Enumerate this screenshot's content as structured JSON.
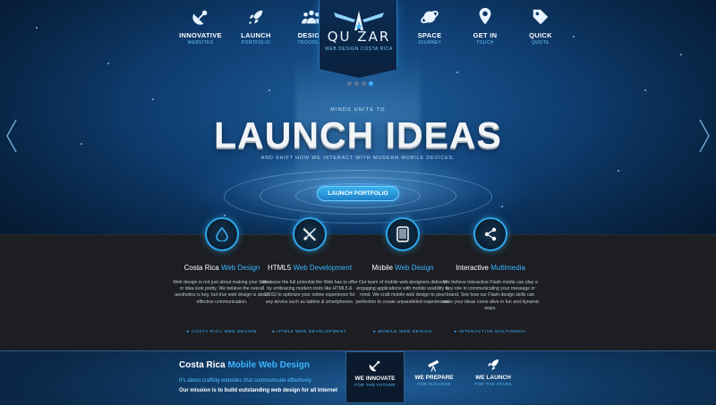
{
  "nav": {
    "left": [
      {
        "label": "INNOVATIVE",
        "sub": "WEBSITES",
        "icon": "satellite-dish-icon"
      },
      {
        "label": "LAUNCH",
        "sub": "PORTFOLIO",
        "icon": "rocket-icon"
      },
      {
        "label": "DESIGN",
        "sub": "TROOPERS",
        "icon": "team-icon"
      }
    ],
    "right": [
      {
        "label": "SPACE",
        "sub": "JOURNEY",
        "icon": "planet-icon"
      },
      {
        "label": "GET IN",
        "sub": "TOUCH",
        "icon": "map-pin-icon"
      },
      {
        "label": "QUICK",
        "sub": "QUOTE",
        "icon": "price-tag-icon"
      }
    ]
  },
  "logo": {
    "text": "QU  ZAR",
    "sub": "WEB DESIGN COSTA RICA",
    "icon": "quazar-logo-icon"
  },
  "slider": {
    "dots": 4,
    "active_index": 3
  },
  "hero": {
    "kicker": "MINDS UNITE TO",
    "headline": "LAUNCH IDEAS",
    "subline": "AND SHIFT HOW WE INTERACT WITH MODERN MOBILE DEVICES.",
    "cta": "LAUNCH PORTFOLIO"
  },
  "services": [
    {
      "icon": "drop-icon",
      "title_pre": "Costa Rica ",
      "title_hl": "Web Design",
      "body": "Web design is not just about making your brand or idea look pretty. We believe the overall aesthetics is key, but true web design is about effective communication.",
      "link": "COSTA RICA WEB DESIGN"
    },
    {
      "icon": "tools-icon",
      "title_pre": "HTML5 ",
      "title_hl": "Web Development",
      "body": "We seize the full potential the Web has to offer by embracing modern tools like HTML5 & CSS3 to optimize your online experience for any device such as tablets & smartphones.",
      "link": "HTML5 WEB DEVELOPMENT"
    },
    {
      "icon": "tablet-icon",
      "title_pre": "Mobile ",
      "title_hl": "Web Design",
      "body": "Our team of mobile web designers delivers engaging applications with mobile usability in mind. We craft mobile web design to pixel perfection to create unparalleled experiences.",
      "link": "MOBILE WEB DESIGN"
    },
    {
      "icon": "share-icon",
      "title_pre": "Interactive ",
      "title_hl": "Multimedia",
      "body": "We believe interactive Flash media can play a key role in communicating your message or brand.  See how our Flash design skills can make your ideas come alive in fun and dynamic ways.",
      "link": "INTERACTIVE MULTIMEDIA"
    }
  ],
  "bottom": {
    "title_pre": "Costa Rica ",
    "title_hl": "Mobile Web Design",
    "line1": "It's about crafting websites that communicate effectively.",
    "line2": "Our mission is to build outstanding web design for all Internet",
    "tabs": [
      {
        "label": "WE INNOVATE",
        "sub": "FOR THE FUTURE",
        "icon": "satellite-dish-icon"
      },
      {
        "label": "WE PREPARE",
        "sub": "FOR SUCCESS",
        "icon": "telescope-icon"
      },
      {
        "label": "WE LAUNCH",
        "sub": "FOR THE STARS",
        "icon": "rocket-icon"
      }
    ]
  },
  "colors": {
    "accent": "#3cb4ff",
    "hero_bg": "#0f3e72",
    "services_bg": "#1a1c20"
  }
}
